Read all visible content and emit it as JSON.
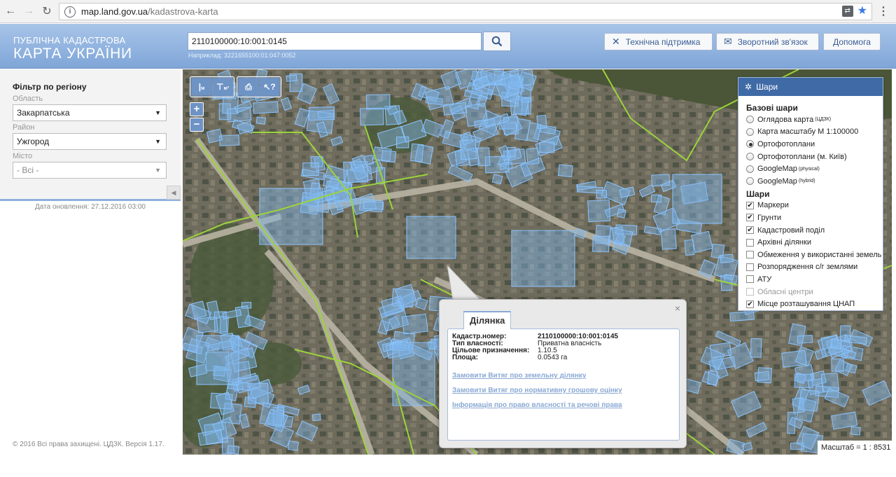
{
  "browser": {
    "url_host": "map.land.gov.ua",
    "url_path": "/kadastrova-karta"
  },
  "header": {
    "logo_top": "ПУБЛІЧНА КАДАСТРОВА",
    "logo_bottom": "КАРТА УКРАЇНИ",
    "search_value": "2110100000:10:001:0145",
    "search_hint": "Наприклад: 3221655100:01:047:0052",
    "buttons": {
      "support": "Технічна підтримка",
      "feedback": "Зворотний зв'язок",
      "help": "Допомога"
    }
  },
  "sidebar": {
    "title": "Фільтр по регіону",
    "oblast_label": "Область",
    "oblast_value": "Закарпатська",
    "rayon_label": "Район",
    "rayon_value": "Ужгород",
    "city_label": "Місто",
    "city_value": "- Всі -",
    "update_date": "Дата оновлення: 27.12.2016 03:00",
    "copyright": "© 2016 Всі права захищені. ЦДЗК. Версія 1.17."
  },
  "toolbar": {
    "ruler_label": "м",
    "area_label": "м²"
  },
  "layers": {
    "title": "Шари",
    "base_title": "Базові шари",
    "base": [
      {
        "label": "Оглядова карта",
        "sup": "(ЦДЗК)",
        "selected": false
      },
      {
        "label": "Карта масштабу М 1:100000",
        "sup": "",
        "selected": false
      },
      {
        "label": "Ортофотоплани",
        "sup": "",
        "selected": true
      },
      {
        "label": "Ортофотоплани (м. Київ)",
        "sup": "",
        "selected": false
      },
      {
        "label": "GoogleMap",
        "sup": "(physical)",
        "selected": false
      },
      {
        "label": "GoogleMap",
        "sup": "(hybrid)",
        "selected": false
      }
    ],
    "layers_title": "Шари",
    "items": [
      {
        "label": "Маркери",
        "checked": true,
        "disabled": false
      },
      {
        "label": "Грунти",
        "checked": true,
        "disabled": false
      },
      {
        "label": "Кадастровий поділ",
        "checked": true,
        "disabled": false
      },
      {
        "label": "Архівні ділянки",
        "checked": false,
        "disabled": false
      },
      {
        "label": "Обмеження у використанні земель",
        "checked": false,
        "disabled": false
      },
      {
        "label": "Розпорядження с/г землями",
        "checked": false,
        "disabled": false
      },
      {
        "label": "АТУ",
        "checked": false,
        "disabled": false
      },
      {
        "label": "Обласні центри",
        "checked": false,
        "disabled": true
      },
      {
        "label": "Місце розташування ЦНАП",
        "checked": true,
        "disabled": false
      }
    ]
  },
  "popup": {
    "tab": "Ділянка",
    "close": "×",
    "fields": [
      {
        "key": "Кадастр.номер:",
        "value": "2110100000:10:001:0145",
        "bold": true
      },
      {
        "key": "Тип власності:",
        "value": "Приватна власність",
        "bold": false
      },
      {
        "key": "Цільове призначення:",
        "value": "1.10.5",
        "bold": false
      },
      {
        "key": "Площа:",
        "value": "0.0543 га",
        "bold": false
      }
    ],
    "links": [
      "Замовити Витяг про земельну ділянку",
      "Замовити Витяг про нормативну грошову оцінку",
      "Інформація про право власності та речові права"
    ]
  },
  "map": {
    "scale": "Масштаб = 1 : 8531"
  },
  "colors": {
    "header_top": "#a8c4e8",
    "header_bottom": "#7fa6d8",
    "parcel": "#7fb6ec",
    "boundary": "#9cd43a",
    "panel_head": "#3f6aa6"
  }
}
